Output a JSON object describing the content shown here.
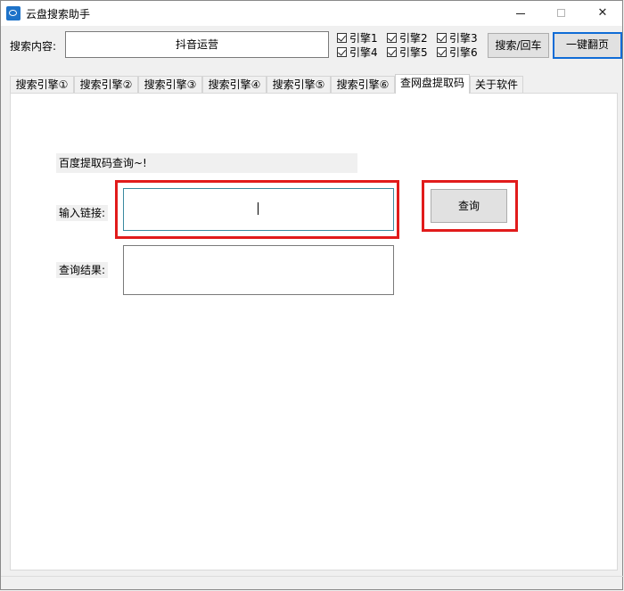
{
  "window": {
    "title": "云盘搜索助手"
  },
  "search": {
    "label": "搜索内容:",
    "value": "抖音运营",
    "engines": [
      {
        "label": "引擎1",
        "checked": true
      },
      {
        "label": "引擎2",
        "checked": true
      },
      {
        "label": "引擎3",
        "checked": true
      },
      {
        "label": "引擎4",
        "checked": true
      },
      {
        "label": "引擎5",
        "checked": true
      },
      {
        "label": "引擎6",
        "checked": true
      }
    ],
    "search_button": "搜索/回车",
    "next_page_button": "一键翻页"
  },
  "tabs": [
    {
      "label": "搜索引擎①",
      "active": false
    },
    {
      "label": "搜索引擎②",
      "active": false
    },
    {
      "label": "搜索引擎③",
      "active": false
    },
    {
      "label": "搜索引擎④",
      "active": false
    },
    {
      "label": "搜索引擎⑤",
      "active": false
    },
    {
      "label": "搜索引擎⑥",
      "active": false
    },
    {
      "label": "查网盘提取码",
      "active": true
    },
    {
      "label": "关于软件",
      "active": false
    }
  ],
  "extract_code": {
    "hint": "百度提取码查询~!",
    "link_label": "输入链接:",
    "link_value": "",
    "query_button": "查询",
    "result_label": "查询结果:",
    "result_value": ""
  },
  "colors": {
    "highlight": "#e11b1b",
    "accent": "#0f6cd6"
  }
}
